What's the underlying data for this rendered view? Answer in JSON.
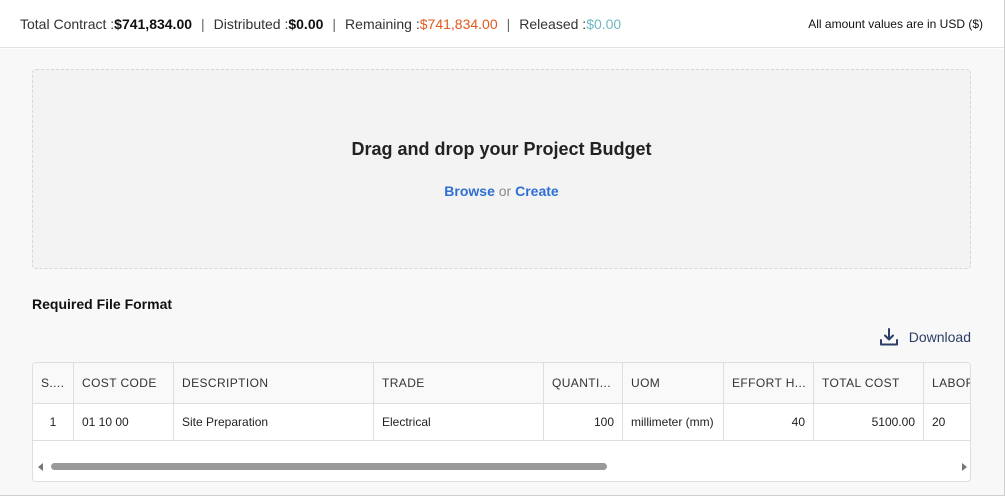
{
  "summary": {
    "total_contract_label": "Total Contract : ",
    "total_contract_value": "$741,834.00",
    "distributed_label": "Distributed : ",
    "distributed_value": "$0.00",
    "remaining_label": "Remaining : ",
    "remaining_value": "$741,834.00",
    "released_label": "Released : ",
    "released_value": "$0.00",
    "separator": "|",
    "usd_note": "All amount values are in USD ($)"
  },
  "dropzone": {
    "title": "Drag and drop your Project Budget",
    "browse_label": "Browse",
    "or_label": "or",
    "create_label": "Create"
  },
  "required_format": {
    "title": "Required File Format",
    "download_label": "Download"
  },
  "table": {
    "columns": [
      "S....",
      "COST CODE",
      "DESCRIPTION",
      "TRADE",
      "QUANTI...",
      "UOM",
      "EFFORT H...",
      "TOTAL COST",
      "LABOR"
    ],
    "rows": [
      [
        "1",
        "01 10 00",
        "Site Preparation",
        "Electrical",
        "100",
        "millimeter (mm)",
        "40",
        "5100.00",
        "20"
      ]
    ]
  },
  "colors": {
    "remaining": "#e0581e",
    "released": "#6cb9c2",
    "link": "#2f6fd1",
    "download": "#2a3e66"
  }
}
